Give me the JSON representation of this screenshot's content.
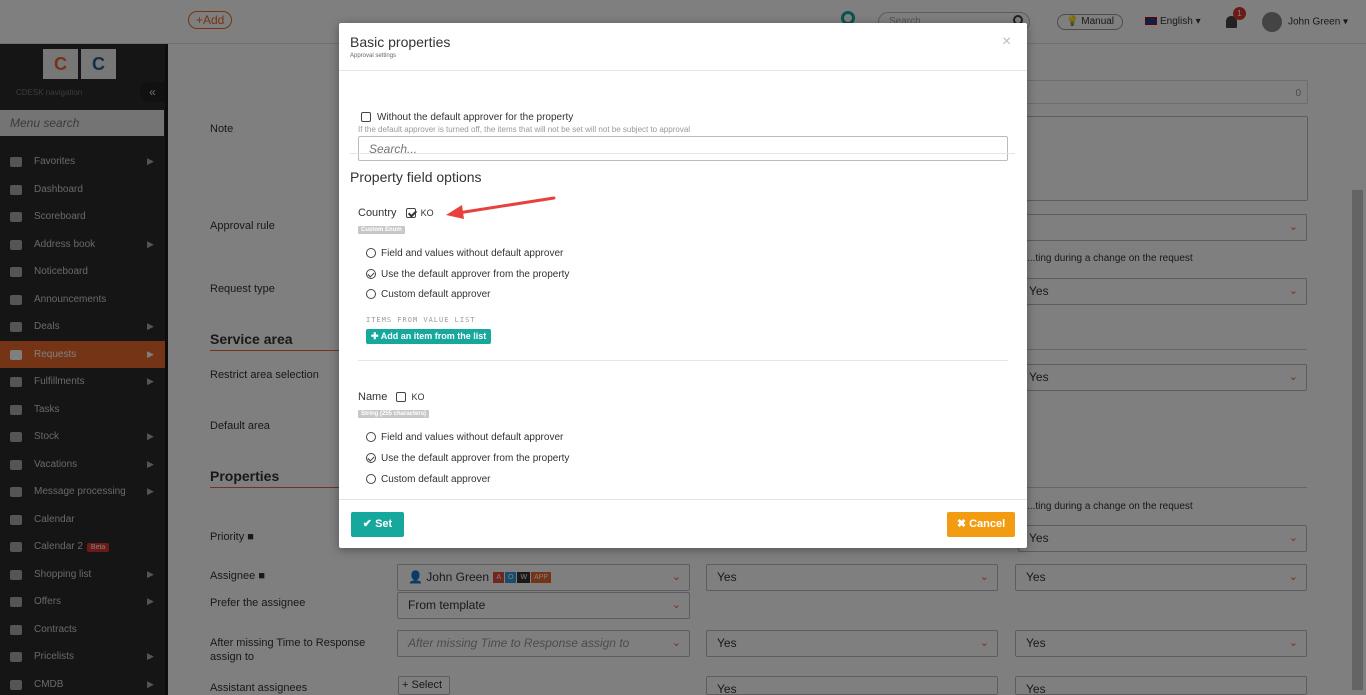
{
  "topbar": {
    "add_label": "+Add",
    "search_placeholder": "Search",
    "manual_label": "Manual",
    "language": "English",
    "notifications_count": "1",
    "user_name": "John Green"
  },
  "sidebar": {
    "nav_label": "CDESK navigation",
    "search_placeholder": "Menu search",
    "items": [
      {
        "label": "Favorites",
        "arrow": true
      },
      {
        "label": "Dashboard",
        "arrow": false
      },
      {
        "label": "Scoreboard",
        "arrow": false
      },
      {
        "label": "Address book",
        "arrow": true
      },
      {
        "label": "Noticeboard",
        "arrow": false
      },
      {
        "label": "Announcements",
        "arrow": false
      },
      {
        "label": "Deals",
        "arrow": true
      },
      {
        "label": "Requests",
        "arrow": true,
        "active": true
      },
      {
        "label": "Fulfillments",
        "arrow": true
      },
      {
        "label": "Tasks",
        "arrow": false
      },
      {
        "label": "Stock",
        "arrow": true
      },
      {
        "label": "Vacations",
        "arrow": true
      },
      {
        "label": "Message processing",
        "arrow": true
      },
      {
        "label": "Calendar",
        "arrow": false
      },
      {
        "label": "Calendar 2",
        "arrow": false,
        "badge": "Beta"
      },
      {
        "label": "Shopping list",
        "arrow": true
      },
      {
        "label": "Offers",
        "arrow": true
      },
      {
        "label": "Contracts",
        "arrow": false
      },
      {
        "label": "Pricelists",
        "arrow": true
      },
      {
        "label": "CMDB",
        "arrow": true
      }
    ]
  },
  "background": {
    "note_label": "Note",
    "approval_rule_label": "Approval rule",
    "request_type_label": "Request type",
    "service_area_title": "Service area",
    "restrict_area_label": "Restrict area selection",
    "default_area_label": "Default area",
    "properties_title": "Properties",
    "priority_label": "Priority",
    "assignee_label": "Assignee",
    "prefer_assignee_label": "Prefer the assignee",
    "after_missing_label": "After missing Time to Response assign to",
    "assistant_label": "Assistant assignees",
    "change_text": "...ting during a change on the request",
    "yes": "Yes",
    "assignee_value": "John Green",
    "assignee_badges": [
      "A",
      "O",
      "W",
      "APP"
    ],
    "prefer_value": "From template",
    "after_missing_placeholder": "After missing Time to Response assign to",
    "select_label": "+ Select",
    "counter": "0"
  },
  "modal": {
    "title": "Basic properties",
    "subtitle": "Approval settings",
    "close_symbol": "×",
    "without_default_label": "Without the default approver for the property",
    "without_default_hint": "If the default approver is turned off, the items that will not be set will not be subject to approval",
    "search_placeholder": "Search...",
    "section_title": "Property field options",
    "properties": [
      {
        "name": "Country",
        "checked": true,
        "code": "KO",
        "type": "Custom Enum",
        "options": [
          {
            "label": "Field and values without default approver",
            "checked": false
          },
          {
            "label": "Use the default approver from the property",
            "checked": true
          },
          {
            "label": "Custom default approver",
            "checked": false
          }
        ],
        "items_label": "ITEMS FROM VALUE LIST",
        "add_item_label": "✚ Add an item from the list"
      },
      {
        "name": "Name",
        "checked": false,
        "code": "KO",
        "type": "String (255 characters)",
        "options": [
          {
            "label": "Field and values without default approver",
            "checked": false
          },
          {
            "label": "Use the default approver from the property",
            "checked": true
          },
          {
            "label": "Custom default approver",
            "checked": false
          }
        ]
      }
    ],
    "set_label": "✔ Set",
    "cancel_label": "✖ Cancel"
  },
  "colors": {
    "accent": "#e8692a",
    "teal": "#16a79d",
    "cancel": "#f39c12",
    "arrow": "#e8413c"
  }
}
